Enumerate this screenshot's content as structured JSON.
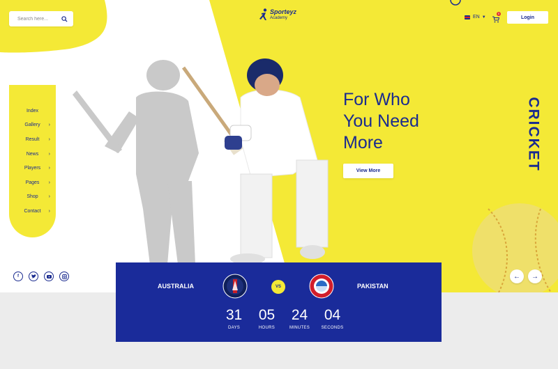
{
  "header": {
    "search_placeholder": "Search here...",
    "logo_name": "Sporteyz",
    "logo_sub": "Academy",
    "language": "EN",
    "cart_count": "0",
    "login_label": "Login"
  },
  "sidebar": {
    "items": [
      {
        "label": "Index",
        "has_submenu": false
      },
      {
        "label": "Gallery",
        "has_submenu": true
      },
      {
        "label": "Result",
        "has_submenu": true
      },
      {
        "label": "News",
        "has_submenu": true
      },
      {
        "label": "Players",
        "has_submenu": true
      },
      {
        "label": "Pages",
        "has_submenu": true
      },
      {
        "label": "Shop",
        "has_submenu": true
      },
      {
        "label": "Contact",
        "has_submenu": true
      }
    ]
  },
  "social": [
    "facebook-icon",
    "twitter-icon",
    "youtube-icon",
    "instagram-icon"
  ],
  "hero": {
    "headline_line1": "For Who",
    "headline_line2": "You Need",
    "headline_line3": "More",
    "cta_label": "View More",
    "side_label": "CRICKET"
  },
  "match": {
    "team_a": "AUSTRALIA",
    "team_b": "PAKISTAN",
    "vs": "VS",
    "countdown": [
      {
        "value": "31",
        "label": "DAYS"
      },
      {
        "value": "05",
        "label": "HOURS"
      },
      {
        "value": "24",
        "label": "MINUTES"
      },
      {
        "value": "04",
        "label": "SECONDS"
      }
    ]
  },
  "colors": {
    "brand_blue": "#1a2b8f",
    "accent_yellow": "#f4e936",
    "score_bg": "#1a2b9a"
  }
}
